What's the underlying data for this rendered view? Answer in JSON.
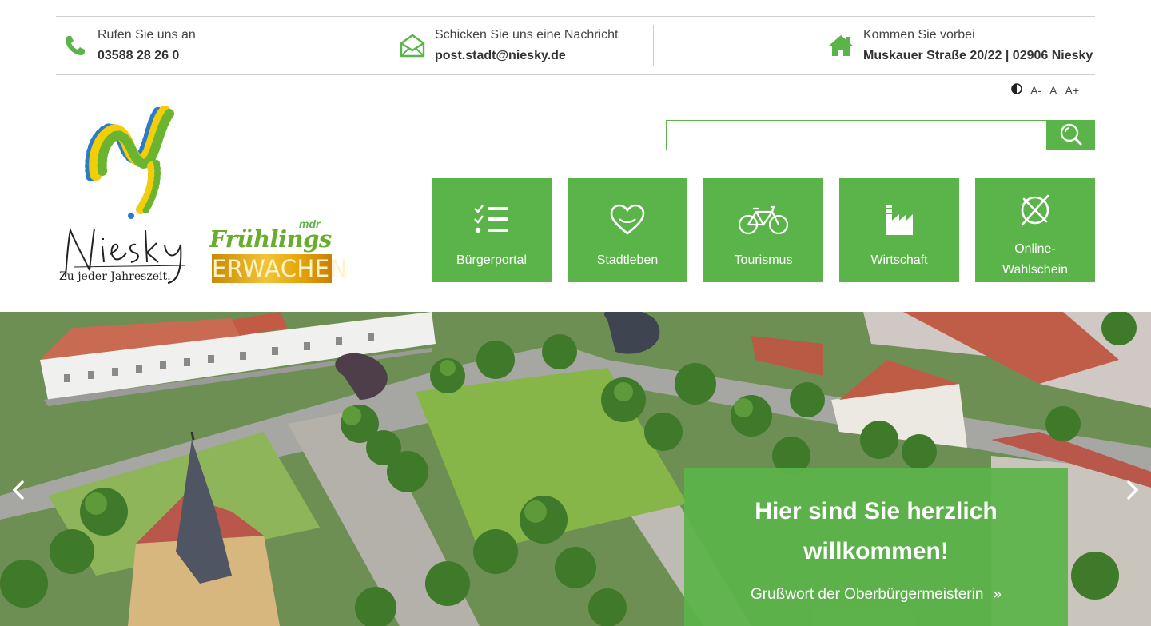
{
  "contact": {
    "phone": {
      "label": "Rufen Sie uns an",
      "value": "03588 28 26 0"
    },
    "mail": {
      "label": "Schicken Sie uns eine Nachricht",
      "value": "post.stadt@niesky.de"
    },
    "visit": {
      "label": "Kommen Sie vorbei",
      "value": "Muskauer Straße 20/22 | 02906 Niesky"
    }
  },
  "accessibility": {
    "smaller": "A-",
    "normal": "A",
    "larger": "A+"
  },
  "logo": {
    "name": "Niesky",
    "slogan": "Zu jeder Jahreszeit."
  },
  "campaign": {
    "tag": "mdr",
    "title": "Frühlings",
    "subtitle": "ERWACHEN"
  },
  "search": {
    "placeholder": "",
    "value": ""
  },
  "tiles": [
    {
      "label": "Bürgerportal",
      "icon": "checklist-icon"
    },
    {
      "label": "Stadtleben",
      "icon": "heart-icon"
    },
    {
      "label": "Tourismus",
      "icon": "bicycle-icon"
    },
    {
      "label": "Wirtschaft",
      "icon": "factory-icon"
    },
    {
      "label": "Online-Wahlschein",
      "label_line1": "Online-",
      "label_line2": "Wahlschein",
      "icon": "ballot-icon"
    }
  ],
  "hero": {
    "title": "Hier sind Sie herzlich willkommen!",
    "link": "Grußwort der Oberbürgermeisterin",
    "link_chevron": "»"
  },
  "colors": {
    "brand_green": "#5bb44a",
    "text": "#333333",
    "divider": "#cfcfcf"
  }
}
